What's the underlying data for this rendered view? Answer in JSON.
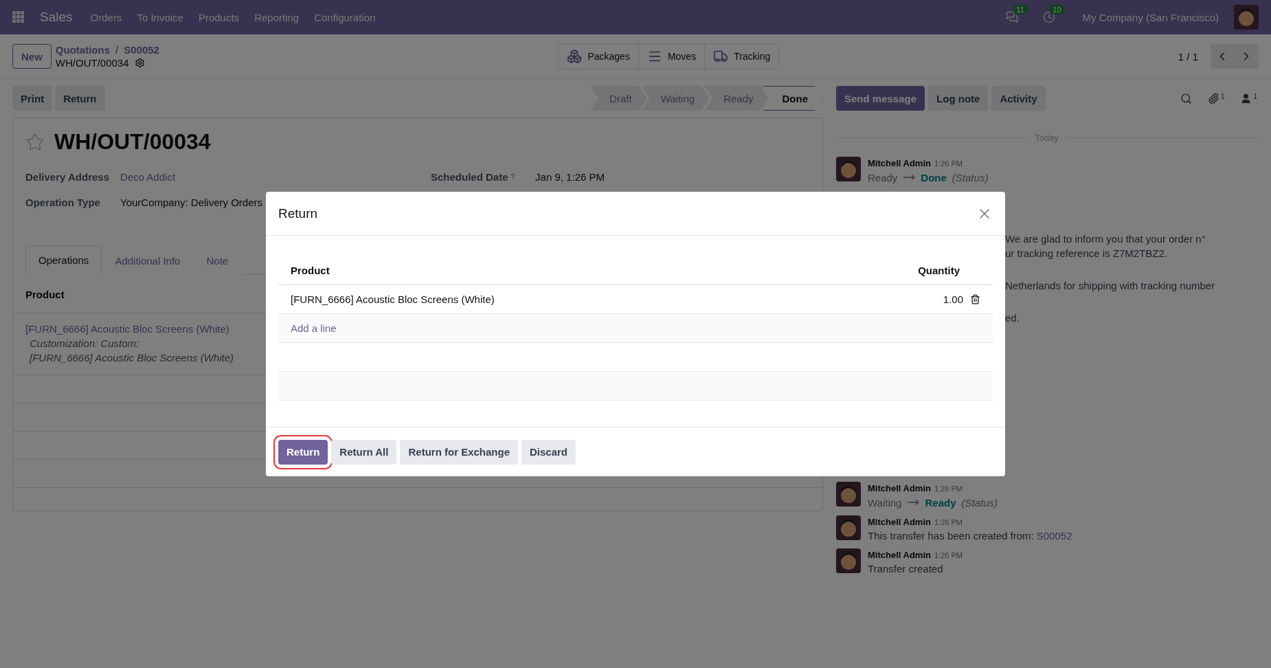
{
  "navbar": {
    "app": "Sales",
    "menu": [
      "Orders",
      "To Invoice",
      "Products",
      "Reporting",
      "Configuration"
    ],
    "messages_badge": "11",
    "activities_badge": "10",
    "company": "My Company (San Francisco)"
  },
  "control_panel": {
    "new_button": "New",
    "breadcrumbs": [
      "Quotations",
      "S00052"
    ],
    "breadcrumb_separator": "/",
    "record": "WH/OUT/00034",
    "smart_buttons": [
      {
        "kind": "packages",
        "label": "Packages"
      },
      {
        "kind": "moves",
        "label": "Moves"
      },
      {
        "kind": "tracking",
        "label": "Tracking"
      }
    ],
    "pager": "1 / 1"
  },
  "actions": [
    "Print",
    "Return"
  ],
  "statusbar": [
    {
      "label": "Draft",
      "selected": false
    },
    {
      "label": "Waiting",
      "selected": false
    },
    {
      "label": "Ready",
      "selected": false
    },
    {
      "label": "Done",
      "selected": true
    }
  ],
  "form": {
    "title": "WH/OUT/00034",
    "starred": false,
    "fields": [
      {
        "label": "Delivery Address",
        "value": "Deco Addict",
        "link": true
      },
      {
        "label": "Operation Type",
        "value": "YourCompany: Delivery Orders",
        "link": false
      }
    ],
    "scheduled": {
      "label": "Scheduled Date",
      "help": "?",
      "value": "Jan 9, 1:26 PM"
    },
    "tabs": [
      {
        "label": "Operations",
        "selected": true
      },
      {
        "label": "Additional Info",
        "selected": false
      },
      {
        "label": "Note",
        "selected": false
      }
    ],
    "table": {
      "columns": [
        "Product"
      ],
      "rows": [
        {
          "product": "[FURN_6666] Acoustic Bloc Screens (White)",
          "note": [
            "Customization: Custom:",
            "[FURN_6666] Acoustic Bloc Screens (White)"
          ]
        }
      ]
    }
  },
  "chatter": {
    "buttons": [
      {
        "label": "Send message",
        "selected": true
      },
      {
        "label": "Log note",
        "selected": false
      },
      {
        "label": "Activity",
        "selected": false
      }
    ],
    "attachments": "1",
    "followers": "1",
    "separator": "Today",
    "messages": [
      {
        "kind": "tracking",
        "author": "Mitchell Admin",
        "time": "1:26 PM",
        "from": "Ready",
        "to": "Done",
        "field": "(Status)"
      },
      {
        "kind": "fragment",
        "lines": [
          [
            "We are glad to inform you that your order n°",
            "ur tracking reference is Z7M2TBZ2."
          ],
          [
            "Netherlands for shipping with tracking number"
          ],
          [
            "ed."
          ]
        ]
      },
      {
        "kind": "tracking",
        "author": "Mitchell Admin",
        "time": "1:26 PM",
        "from": "Waiting",
        "to": "Ready",
        "field": "(Status)"
      },
      {
        "kind": "text",
        "author": "Mitchell Admin",
        "time": "1:26 PM",
        "text": "This transfer has been created from:",
        "link": "S00052"
      },
      {
        "kind": "text",
        "author": "Mitchell Admin",
        "time": "1:26 PM",
        "text": "Transfer created"
      }
    ]
  },
  "dialog": {
    "title": "Return",
    "columns": [
      "Product",
      "Quantity"
    ],
    "rows": [
      {
        "product": "[FURN_6666] Acoustic Bloc Screens (White)",
        "quantity": "1.00"
      }
    ],
    "add_line": "Add a line",
    "buttons": [
      {
        "label": "Return",
        "primary": true,
        "highlighted": true
      },
      {
        "label": "Return All",
        "primary": false,
        "highlighted": false
      },
      {
        "label": "Return for Exchange",
        "primary": false,
        "highlighted": false
      },
      {
        "label": "Discard",
        "primary": false,
        "highlighted": false
      }
    ]
  }
}
